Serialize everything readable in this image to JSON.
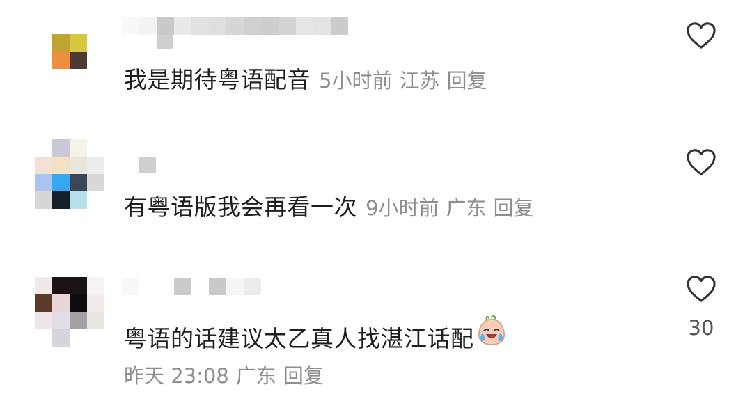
{
  "comments": [
    {
      "text": "我是期待粤语配音",
      "time": "5小时前",
      "location": "江苏",
      "reply": "回复"
    },
    {
      "text": "有粤语版我会再看一次",
      "time": "9小时前",
      "location": "广东",
      "reply": "回复"
    },
    {
      "text": "粤语的话建议太乙真人找湛江话配",
      "emoji": "crying-laughing-emoji",
      "time": "昨天 23:08",
      "location": "广东",
      "reply": "回复",
      "likes": "30"
    }
  ],
  "colors": {
    "body_text": "#1f1f1f",
    "meta_text": "#8e8e8e",
    "icon_stroke": "#333333"
  },
  "icons": {
    "like": "heart-outline-icon"
  }
}
